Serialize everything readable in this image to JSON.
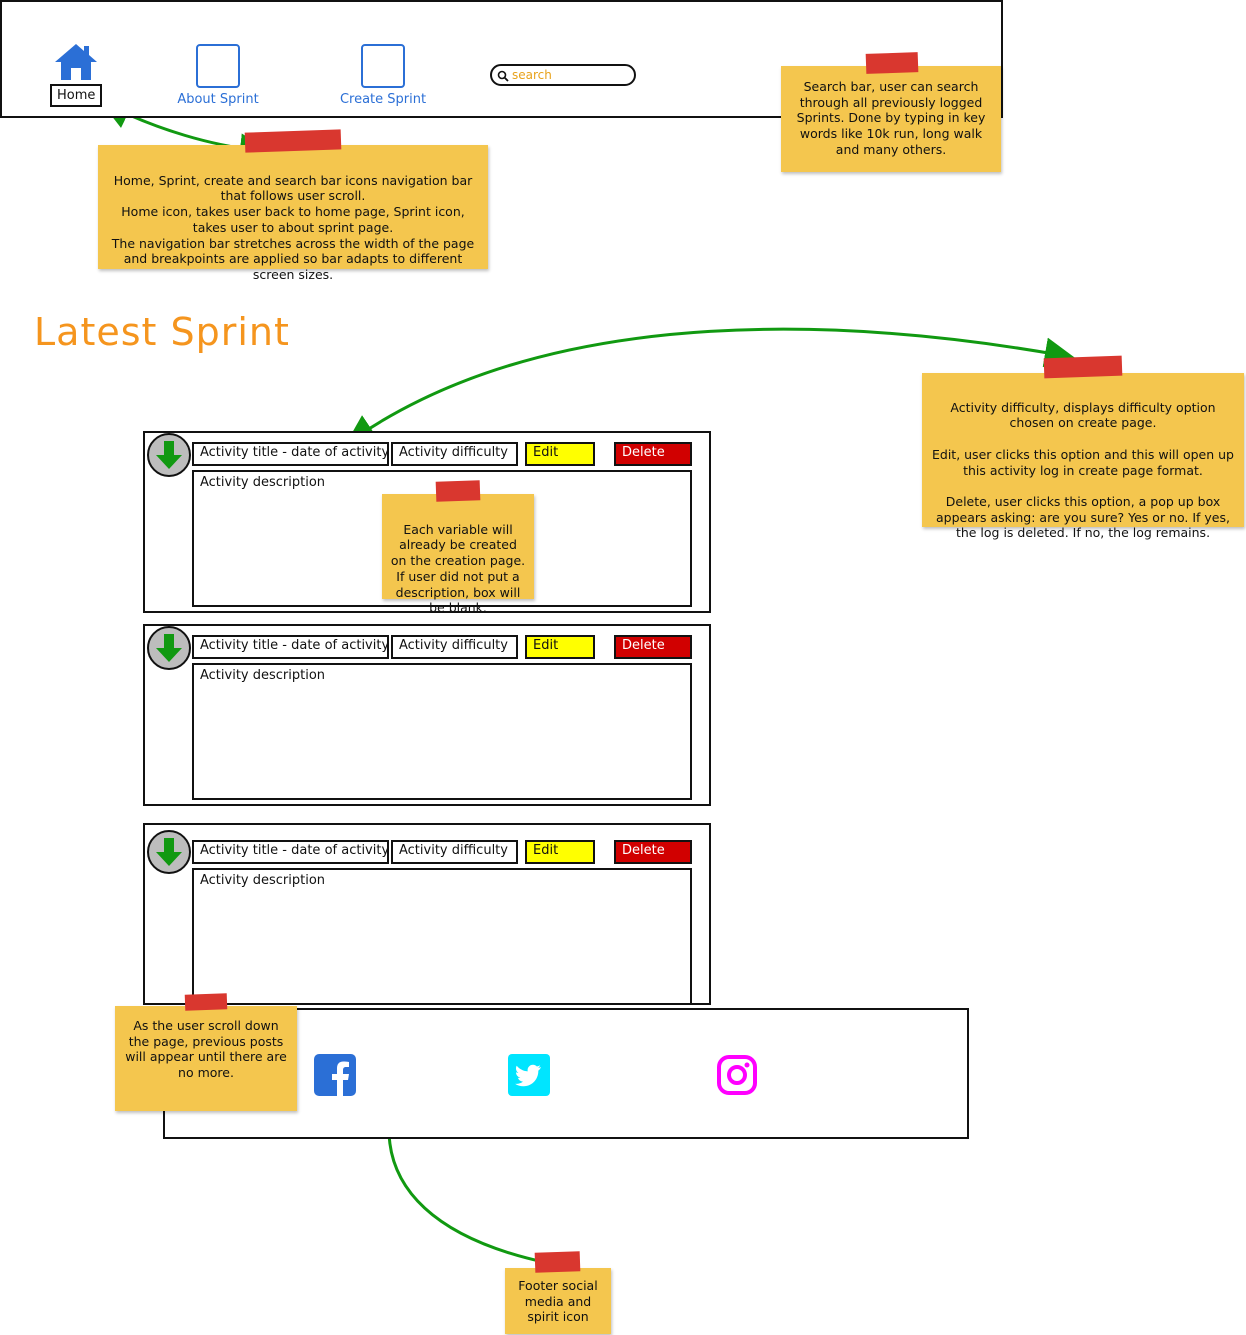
{
  "nav": {
    "home_label": "Home",
    "about_label": "About Sprint",
    "create_label": "Create Sprint",
    "search_placeholder": "search"
  },
  "notes": {
    "search_note": "Search bar, user can search through all previously logged Sprints. Done by typing in key words like 10k run, long walk and many others.",
    "nav_note": "Home, Sprint, create and search bar icons navigation bar that follows user scroll.\nHome icon, takes user back to home page, Sprint icon, takes user to about sprint page.\nThe navigation bar stretches across the width of the page and breakpoints are applied so bar adapts to different screen sizes.",
    "activity_note": "Activity difficulty, displays difficulty option chosen on create page.\n\nEdit, user clicks this option and this will open up this activity log in create page format.\n\nDelete, user clicks this option, a pop up box appears asking: are you sure? Yes or no. If yes, the log is deleted. If no, the log remains.",
    "variable_note": "Each variable will already be created on the creation page.\nIf user did not put a description, box will be blank.",
    "scroll_note": "As the user scroll down the page, previous posts will appear until there are no more.",
    "footer_note": "Footer social media and spirit icon"
  },
  "page_title": "Latest Sprint",
  "cards": [
    {
      "title": "Activity title - date of activity",
      "difficulty": "Activity difficulty",
      "edit": "Edit",
      "delete": "Delete",
      "description": "Activity description"
    },
    {
      "title": "Activity title - date of activity",
      "difficulty": "Activity difficulty",
      "edit": "Edit",
      "delete": "Delete",
      "description": "Activity description"
    },
    {
      "title": "Activity title - date of activity",
      "difficulty": "Activity difficulty",
      "edit": "Edit",
      "delete": "Delete",
      "description": "Activity description"
    }
  ],
  "footer": {
    "icons": [
      "facebook-icon",
      "twitter-icon",
      "instagram-icon"
    ]
  },
  "colors": {
    "accent_orange": "#f5951e",
    "nav_blue": "#2b6fd6",
    "note_yellow": "#f4c64e",
    "tape_red": "#d9372f",
    "edit_yellow": "#ffff00",
    "delete_red": "#d10000",
    "arrow_green": "#119911",
    "facebook_blue": "#2b6fd6",
    "twitter_cyan": "#00e5ff",
    "instagram_magenta": "#ff00ff"
  }
}
